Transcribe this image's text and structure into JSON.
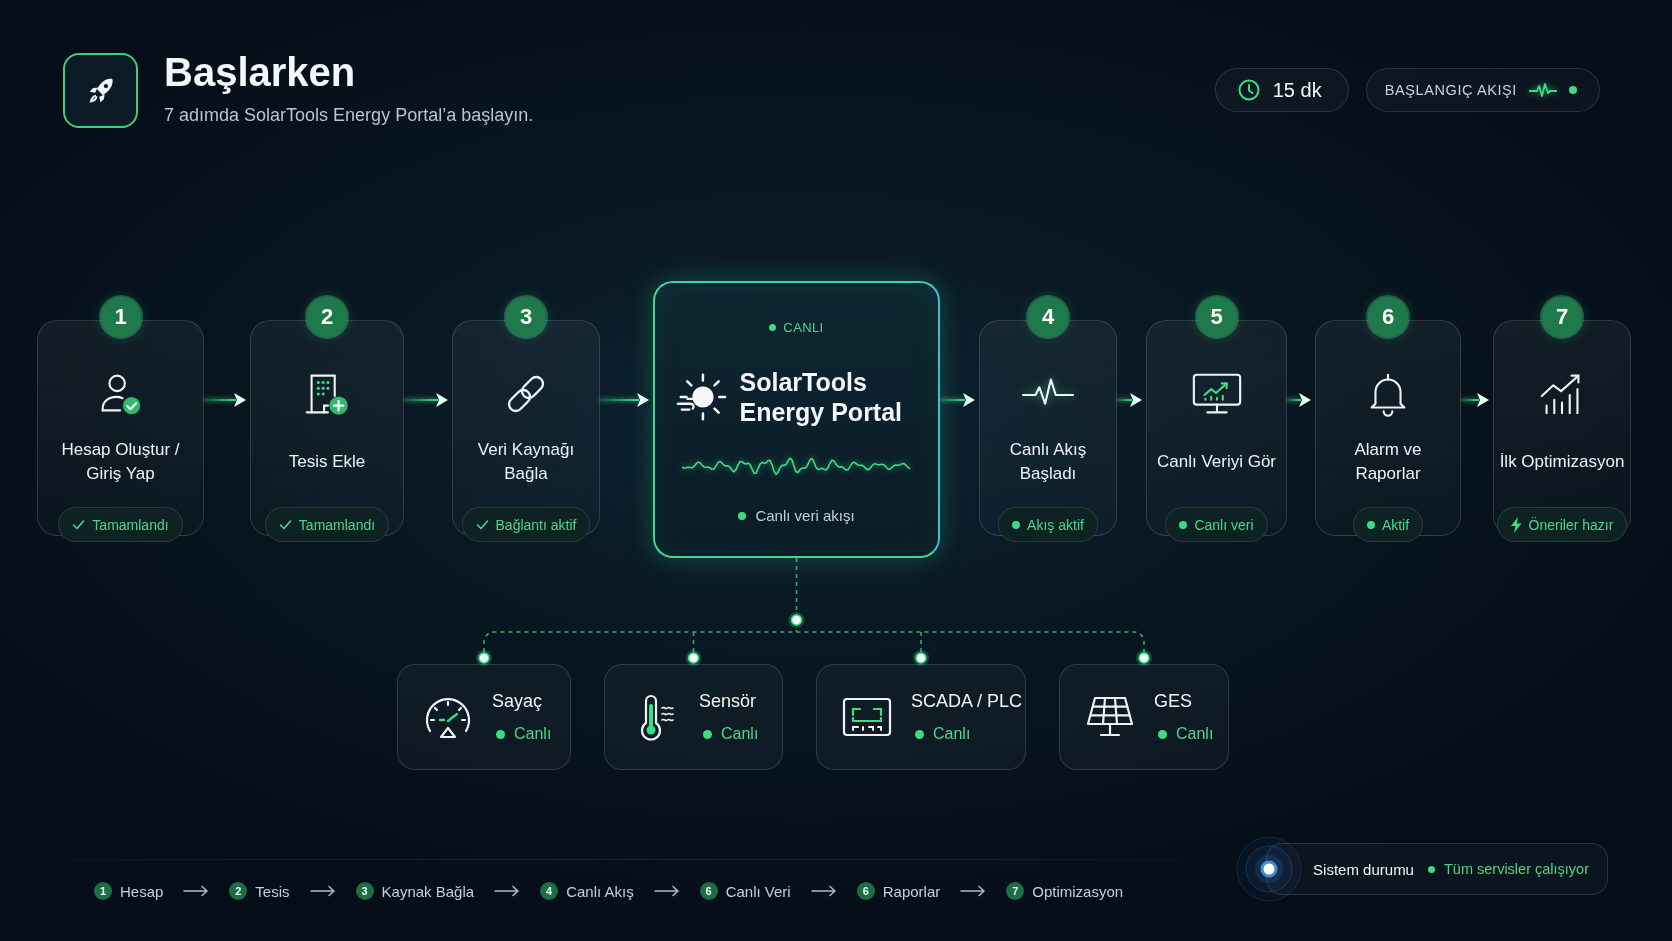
{
  "header": {
    "title": "Başlarken",
    "subtitle": "7 adımda SolarTools Energy Portal’a başlayın."
  },
  "top_badges": {
    "duration": "15 dk",
    "flow_label": "BAŞLANGIÇ AKIŞI"
  },
  "flow": [
    {
      "kind": "step",
      "number": "1",
      "title": "Hesap Oluştur / Giriş Yap",
      "status": {
        "kind": "done",
        "label": "Tamamlandı"
      }
    },
    {
      "kind": "step",
      "number": "2",
      "title": "Tesis Ekle",
      "status": {
        "kind": "done",
        "label": "Tamamlandı"
      }
    },
    {
      "kind": "step",
      "number": "3",
      "title": "Veri Kaynağı Bağla",
      "status": {
        "kind": "done",
        "label": "Bağlantı aktif"
      }
    },
    {
      "kind": "hub",
      "badge": "CANLI",
      "title": "SolarTools Energy Portal",
      "caption": "Canlı veri akışı"
    },
    {
      "kind": "step",
      "number": "4",
      "title": "Canlı Akış Başladı",
      "status": {
        "kind": "live",
        "label": "Akış aktif"
      }
    },
    {
      "kind": "step",
      "number": "5",
      "title": "Canlı Veriyi Gör",
      "status": {
        "kind": "live",
        "label": "Canlı veri"
      }
    },
    {
      "kind": "step",
      "number": "6",
      "title": "Alarm ve Raporlar",
      "status": {
        "kind": "live",
        "label": "Aktif"
      }
    },
    {
      "kind": "step",
      "number": "7",
      "title": "İlk Optimizasyon",
      "status": {
        "kind": "ready",
        "label": "Öneriler hazır"
      }
    }
  ],
  "sources": [
    {
      "name": "Sayaç",
      "status": "Canlı"
    },
    {
      "name": "Sensör",
      "status": "Canlı"
    },
    {
      "name": "SCADA / PLC",
      "status": "Canlı"
    },
    {
      "name": "GES",
      "status": "Canlı"
    }
  ],
  "progress": [
    {
      "number": "1",
      "label": "Hesap"
    },
    {
      "number": "2",
      "label": "Tesis"
    },
    {
      "number": "3",
      "label": "Kaynak Bağla"
    },
    {
      "number": "4",
      "label": "Canlı Akış"
    },
    {
      "number": "6",
      "label": "Canlı Veri"
    },
    {
      "number": "6",
      "label": "Raporlar"
    },
    {
      "number": "7",
      "label": "Optimizasyon"
    }
  ],
  "system_status": {
    "label": "Sistem durumu",
    "status": "Tüm servisler çalışıyor"
  }
}
